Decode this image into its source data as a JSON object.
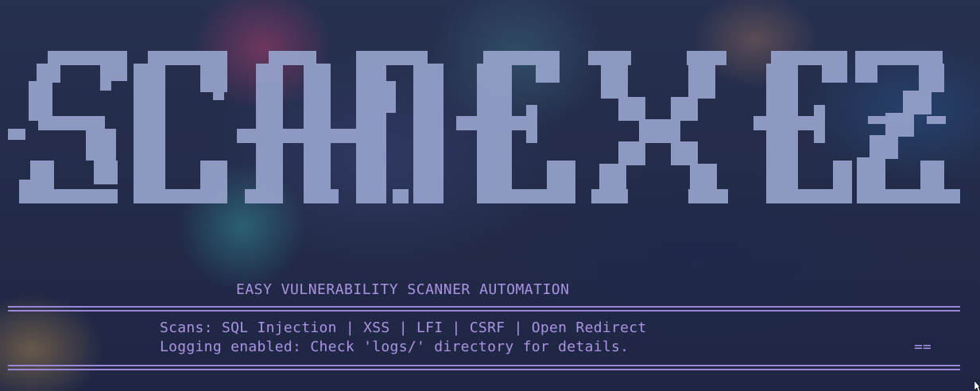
{
  "banner": {
    "text": "SCANEXEZ",
    "color": "#939fc8"
  },
  "subtitle": "EASY VULNERABILITY SCANNER AUTOMATION",
  "info": {
    "scans": "Scans: SQL Injection | XSS | LFI | CSRF | Open Redirect",
    "logging": "Logging enabled: Check 'logs/' directory for details.",
    "trailing": "=="
  },
  "colors": {
    "accent": "#a994e3",
    "rule": "#9b87d8",
    "background": "#232a48"
  },
  "icons": {
    "cursor": "mouse-pointer-icon"
  }
}
